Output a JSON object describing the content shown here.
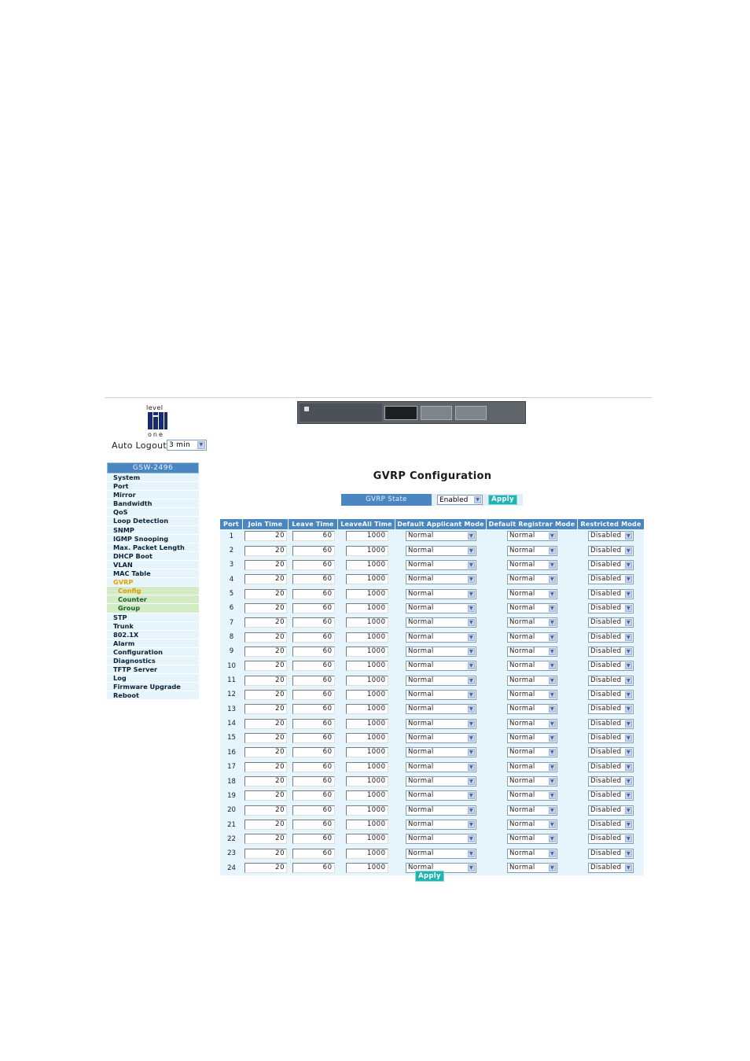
{
  "header": {
    "logo_text_top": "level",
    "logo_text_bottom": "one",
    "auto_logout_label": "Auto Logout",
    "auto_logout_value": "3 min"
  },
  "sidebar": {
    "title": "GSW-2496",
    "items": [
      {
        "label": "System"
      },
      {
        "label": "Port"
      },
      {
        "label": "Mirror"
      },
      {
        "label": "Bandwidth"
      },
      {
        "label": "QoS"
      },
      {
        "label": "Loop Detection"
      },
      {
        "label": "SNMP"
      },
      {
        "label": "IGMP Snooping"
      },
      {
        "label": "Max. Packet Length"
      },
      {
        "label": "DHCP Boot"
      },
      {
        "label": "VLAN"
      },
      {
        "label": "MAC Table"
      },
      {
        "label": "GVRP",
        "active": true
      },
      {
        "label": "Config",
        "sub": true,
        "active": true
      },
      {
        "label": "Counter",
        "sub": true
      },
      {
        "label": "Group",
        "sub": true
      },
      {
        "label": "STP"
      },
      {
        "label": "Trunk"
      },
      {
        "label": "802.1X"
      },
      {
        "label": "Alarm"
      },
      {
        "label": "Configuration"
      },
      {
        "label": "Diagnostics"
      },
      {
        "label": "TFTP Server"
      },
      {
        "label": "Log"
      },
      {
        "label": "Firmware Upgrade"
      },
      {
        "label": "Reboot"
      }
    ]
  },
  "main": {
    "title": "GVRP Configuration",
    "gvrp_state_label": "GVRP State",
    "gvrp_state_value": "Enabled",
    "apply_label": "Apply",
    "bottom_apply_label": "Apply",
    "columns": [
      "Port",
      "Join Time",
      "Leave Time",
      "LeaveAll Time",
      "Default Applicant Mode",
      "Default Registrar Mode",
      "Restricted Mode"
    ],
    "rows": [
      {
        "port": "1",
        "join": "20",
        "leave": "60",
        "leaveall": "1000",
        "applicant": "Normal",
        "registrar": "Normal",
        "restricted": "Disabled"
      },
      {
        "port": "2",
        "join": "20",
        "leave": "60",
        "leaveall": "1000",
        "applicant": "Normal",
        "registrar": "Normal",
        "restricted": "Disabled"
      },
      {
        "port": "3",
        "join": "20",
        "leave": "60",
        "leaveall": "1000",
        "applicant": "Normal",
        "registrar": "Normal",
        "restricted": "Disabled"
      },
      {
        "port": "4",
        "join": "20",
        "leave": "60",
        "leaveall": "1000",
        "applicant": "Normal",
        "registrar": "Normal",
        "restricted": "Disabled"
      },
      {
        "port": "5",
        "join": "20",
        "leave": "60",
        "leaveall": "1000",
        "applicant": "Normal",
        "registrar": "Normal",
        "restricted": "Disabled"
      },
      {
        "port": "6",
        "join": "20",
        "leave": "60",
        "leaveall": "1000",
        "applicant": "Normal",
        "registrar": "Normal",
        "restricted": "Disabled"
      },
      {
        "port": "7",
        "join": "20",
        "leave": "60",
        "leaveall": "1000",
        "applicant": "Normal",
        "registrar": "Normal",
        "restricted": "Disabled"
      },
      {
        "port": "8",
        "join": "20",
        "leave": "60",
        "leaveall": "1000",
        "applicant": "Normal",
        "registrar": "Normal",
        "restricted": "Disabled"
      },
      {
        "port": "9",
        "join": "20",
        "leave": "60",
        "leaveall": "1000",
        "applicant": "Normal",
        "registrar": "Normal",
        "restricted": "Disabled"
      },
      {
        "port": "10",
        "join": "20",
        "leave": "60",
        "leaveall": "1000",
        "applicant": "Normal",
        "registrar": "Normal",
        "restricted": "Disabled"
      },
      {
        "port": "11",
        "join": "20",
        "leave": "60",
        "leaveall": "1000",
        "applicant": "Normal",
        "registrar": "Normal",
        "restricted": "Disabled"
      },
      {
        "port": "12",
        "join": "20",
        "leave": "60",
        "leaveall": "1000",
        "applicant": "Normal",
        "registrar": "Normal",
        "restricted": "Disabled"
      },
      {
        "port": "13",
        "join": "20",
        "leave": "60",
        "leaveall": "1000",
        "applicant": "Normal",
        "registrar": "Normal",
        "restricted": "Disabled"
      },
      {
        "port": "14",
        "join": "20",
        "leave": "60",
        "leaveall": "1000",
        "applicant": "Normal",
        "registrar": "Normal",
        "restricted": "Disabled"
      },
      {
        "port": "15",
        "join": "20",
        "leave": "60",
        "leaveall": "1000",
        "applicant": "Normal",
        "registrar": "Normal",
        "restricted": "Disabled"
      },
      {
        "port": "16",
        "join": "20",
        "leave": "60",
        "leaveall": "1000",
        "applicant": "Normal",
        "registrar": "Normal",
        "restricted": "Disabled"
      },
      {
        "port": "17",
        "join": "20",
        "leave": "60",
        "leaveall": "1000",
        "applicant": "Normal",
        "registrar": "Normal",
        "restricted": "Disabled"
      },
      {
        "port": "18",
        "join": "20",
        "leave": "60",
        "leaveall": "1000",
        "applicant": "Normal",
        "registrar": "Normal",
        "restricted": "Disabled"
      },
      {
        "port": "19",
        "join": "20",
        "leave": "60",
        "leaveall": "1000",
        "applicant": "Normal",
        "registrar": "Normal",
        "restricted": "Disabled"
      },
      {
        "port": "20",
        "join": "20",
        "leave": "60",
        "leaveall": "1000",
        "applicant": "Normal",
        "registrar": "Normal",
        "restricted": "Disabled"
      },
      {
        "port": "21",
        "join": "20",
        "leave": "60",
        "leaveall": "1000",
        "applicant": "Normal",
        "registrar": "Normal",
        "restricted": "Disabled"
      },
      {
        "port": "22",
        "join": "20",
        "leave": "60",
        "leaveall": "1000",
        "applicant": "Normal",
        "registrar": "Normal",
        "restricted": "Disabled"
      },
      {
        "port": "23",
        "join": "20",
        "leave": "60",
        "leaveall": "1000",
        "applicant": "Normal",
        "registrar": "Normal",
        "restricted": "Disabled"
      },
      {
        "port": "24",
        "join": "20",
        "leave": "60",
        "leaveall": "1000",
        "applicant": "Normal",
        "registrar": "Normal",
        "restricted": "Disabled"
      }
    ]
  },
  "colors": {
    "header_blue": "#4a86bf",
    "row_bg": "#e6f4fc",
    "apply_teal": "#1eb4b4",
    "active_orange": "#e6a200",
    "sub_green": "#d2ecc6"
  },
  "icons": {
    "dropdown": "chevron-down-icon",
    "logo": "levelone-logo-icon",
    "device": "switch-device-image"
  }
}
